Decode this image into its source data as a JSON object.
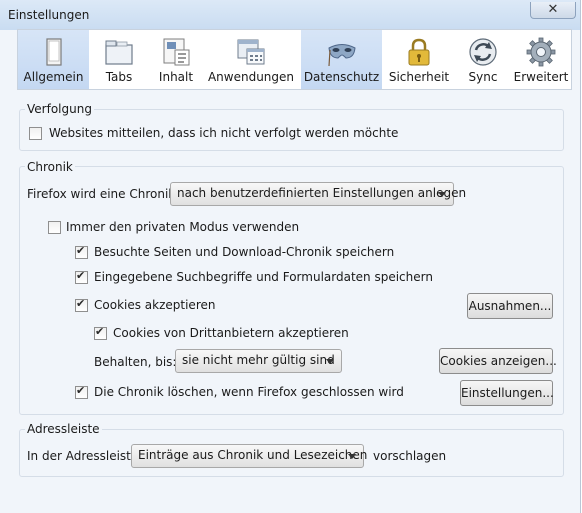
{
  "window": {
    "title": "Einstellungen",
    "close_label": "✕"
  },
  "toolbar": {
    "tabs": [
      {
        "label": "Allgemein",
        "icon": "window-icon",
        "selected": true
      },
      {
        "label": "Tabs",
        "icon": "tabs-icon"
      },
      {
        "label": "Inhalt",
        "icon": "content-icon"
      },
      {
        "label": "Anwendungen",
        "icon": "applications-icon"
      },
      {
        "label": "Datenschutz",
        "icon": "mask-icon",
        "selected": true
      },
      {
        "label": "Sicherheit",
        "icon": "lock-icon"
      },
      {
        "label": "Sync",
        "icon": "sync-icon"
      },
      {
        "label": "Erweitert",
        "icon": "gear-icon"
      }
    ]
  },
  "tracking": {
    "heading": "Verfolgung",
    "do_not_track": {
      "label": "Websites mitteilen, dass ich nicht verfolgt werden möchte",
      "checked": false
    }
  },
  "history": {
    "heading": "Chronik",
    "mode_label": "Firefox wird eine Chronik:",
    "mode_value": "nach benutzerdefinierten Einstellungen anlegen",
    "private_mode": {
      "label": "Immer den privaten Modus verwenden",
      "checked": false
    },
    "remember_history": {
      "label": "Besuchte Seiten und Download-Chronik speichern",
      "checked": true
    },
    "remember_forms": {
      "label": "Eingegebene Suchbegriffe und Formulardaten speichern",
      "checked": true
    },
    "accept_cookies": {
      "label": "Cookies akzeptieren",
      "checked": true
    },
    "exceptions_button": "Ausnahmen...",
    "third_party_cookies": {
      "label": "Cookies von Drittanbietern akzeptieren",
      "checked": true
    },
    "keep_until_label": "Behalten, bis:",
    "keep_until_value": "sie nicht mehr gültig sind",
    "show_cookies_button": "Cookies anzeigen...",
    "clear_on_close": {
      "label": "Die Chronik löschen, wenn Firefox geschlossen wird",
      "checked": true
    },
    "settings_button": "Einstellungen..."
  },
  "location_bar": {
    "heading": "Adressleiste",
    "prefix": "In der Adressleiste",
    "suggest_value": "Einträge aus Chronik und Lesezeichen",
    "suffix": "vorschlagen"
  }
}
